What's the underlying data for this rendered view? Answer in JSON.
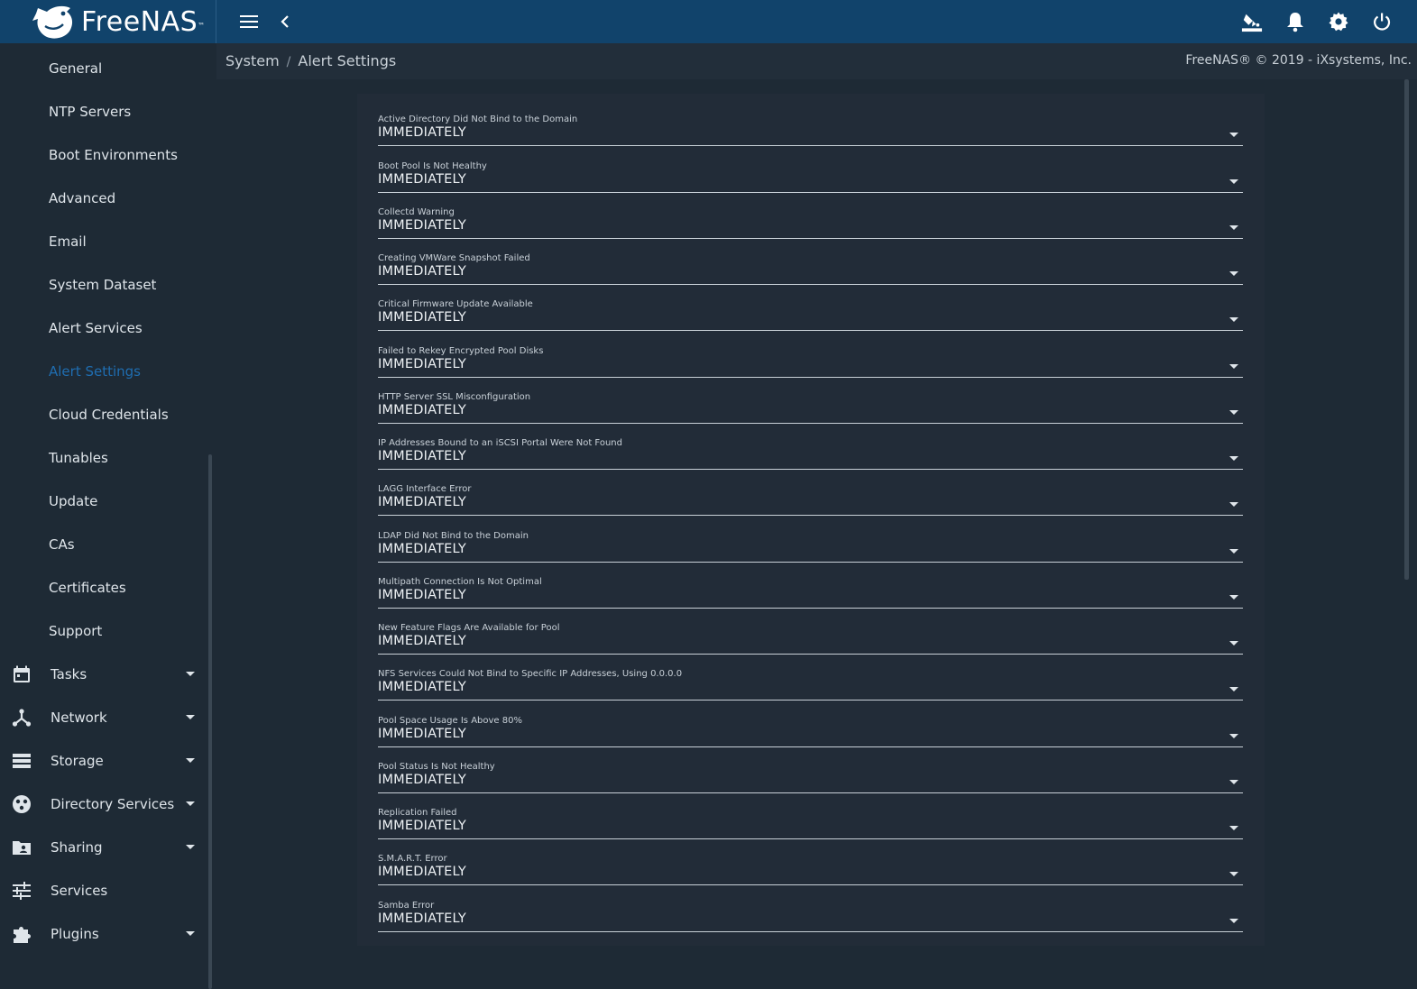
{
  "app": {
    "brand": "FreeNAS",
    "brand_tm": "™",
    "copyright": "FreeNAS® © 2019 - iXsystems, Inc."
  },
  "topbar": {
    "icons": [
      "menu-icon",
      "chevron-left-icon",
      "theme-paint-icon",
      "bell-icon",
      "gear-icon",
      "power-icon"
    ]
  },
  "breadcrumb": {
    "parent": "System",
    "separator": "/",
    "current": "Alert Settings"
  },
  "sidebar": {
    "items": [
      {
        "label": "General"
      },
      {
        "label": "NTP Servers"
      },
      {
        "label": "Boot Environments"
      },
      {
        "label": "Advanced"
      },
      {
        "label": "Email"
      },
      {
        "label": "System Dataset"
      },
      {
        "label": "Alert Services"
      },
      {
        "label": "Alert Settings",
        "active": true
      },
      {
        "label": "Cloud Credentials"
      },
      {
        "label": "Tunables"
      },
      {
        "label": "Update"
      },
      {
        "label": "CAs"
      },
      {
        "label": "Certificates"
      },
      {
        "label": "Support"
      }
    ],
    "sections": [
      {
        "label": "Tasks",
        "icon": "calendar-icon",
        "expandable": true
      },
      {
        "label": "Network",
        "icon": "network-icon",
        "expandable": true
      },
      {
        "label": "Storage",
        "icon": "storage-icon",
        "expandable": true
      },
      {
        "label": "Directory Services",
        "icon": "directory-services-icon",
        "expandable": true
      },
      {
        "label": "Sharing",
        "icon": "sharing-icon",
        "expandable": true
      },
      {
        "label": "Services",
        "icon": "services-tune-icon",
        "expandable": false
      },
      {
        "label": "Plugins",
        "icon": "puzzle-icon",
        "expandable": true
      }
    ]
  },
  "alert_settings": [
    {
      "label": "Active Directory Did Not Bind to the Domain",
      "value": "IMMEDIATELY"
    },
    {
      "label": "Boot Pool Is Not Healthy",
      "value": "IMMEDIATELY"
    },
    {
      "label": "Collectd Warning",
      "value": "IMMEDIATELY"
    },
    {
      "label": "Creating VMWare Snapshot Failed",
      "value": "IMMEDIATELY"
    },
    {
      "label": "Critical Firmware Update Available",
      "value": "IMMEDIATELY"
    },
    {
      "label": "Failed to Rekey Encrypted Pool Disks",
      "value": "IMMEDIATELY"
    },
    {
      "label": "HTTP Server SSL Misconfiguration",
      "value": "IMMEDIATELY"
    },
    {
      "label": "IP Addresses Bound to an iSCSI Portal Were Not Found",
      "value": "IMMEDIATELY"
    },
    {
      "label": "LAGG Interface Error",
      "value": "IMMEDIATELY"
    },
    {
      "label": "LDAP Did Not Bind to the Domain",
      "value": "IMMEDIATELY"
    },
    {
      "label": "Multipath Connection Is Not Optimal",
      "value": "IMMEDIATELY"
    },
    {
      "label": "New Feature Flags Are Available for Pool",
      "value": "IMMEDIATELY"
    },
    {
      "label": "NFS Services Could Not Bind to Specific IP Addresses, Using 0.0.0.0",
      "value": "IMMEDIATELY"
    },
    {
      "label": "Pool Space Usage Is Above 80%",
      "value": "IMMEDIATELY"
    },
    {
      "label": "Pool Status Is Not Healthy",
      "value": "IMMEDIATELY"
    },
    {
      "label": "Replication Failed",
      "value": "IMMEDIATELY"
    },
    {
      "label": "S.M.A.R.T. Error",
      "value": "IMMEDIATELY"
    },
    {
      "label": "Samba Error",
      "value": "IMMEDIATELY"
    }
  ],
  "colors": {
    "topbar": "#11436b",
    "background": "#1e2a35",
    "card": "#222c38",
    "accent": "#1f6db0"
  }
}
